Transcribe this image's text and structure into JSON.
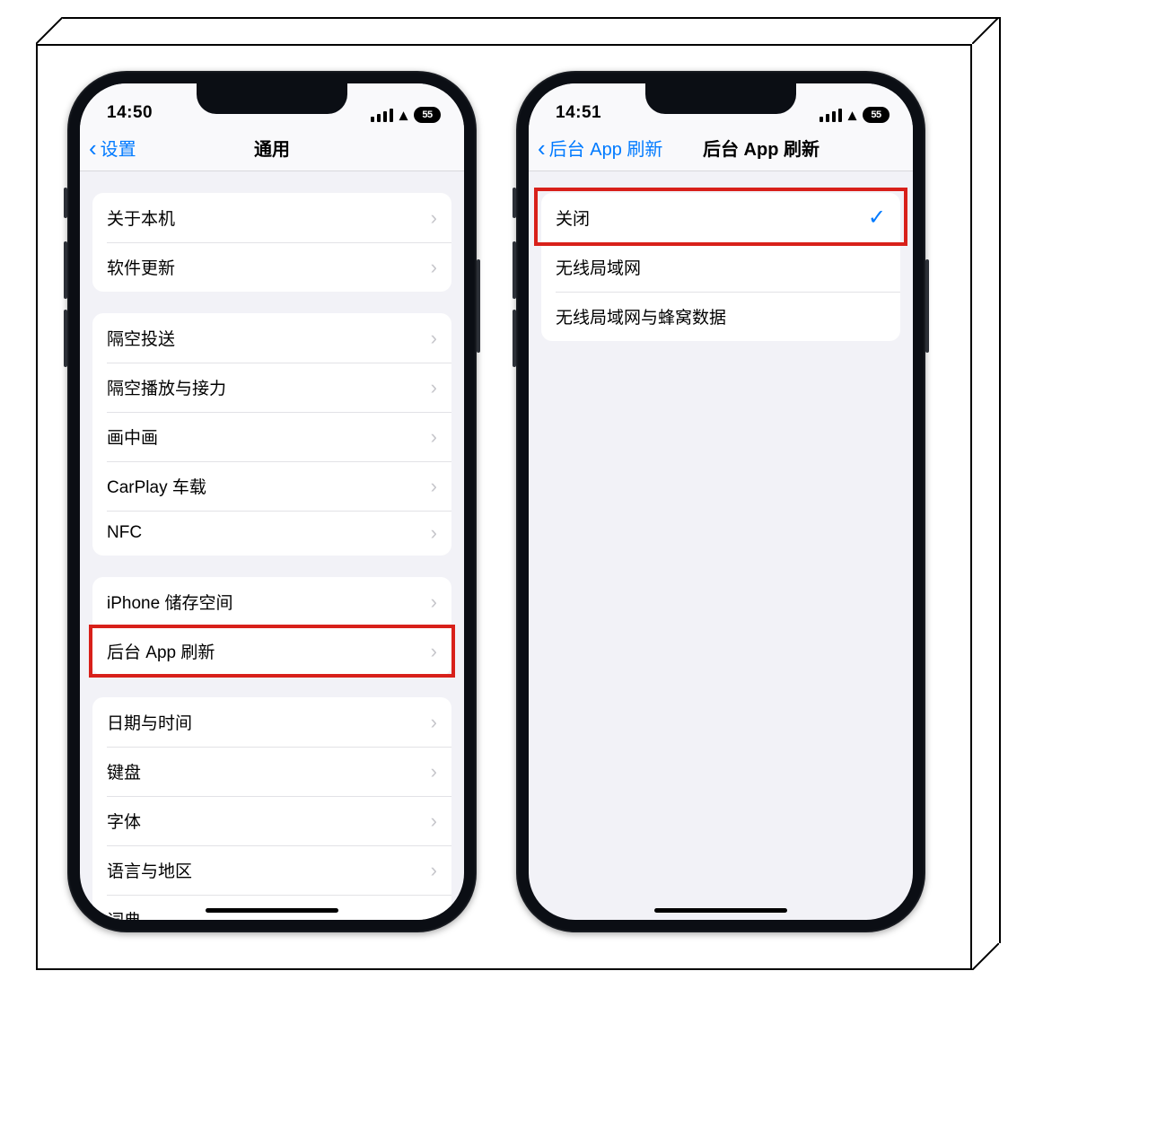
{
  "phoneLeft": {
    "time": "14:50",
    "battery": "55",
    "backLabel": "设置",
    "title": "通用",
    "groups": [
      {
        "rows": [
          {
            "label": "关于本机",
            "name": "row-about"
          },
          {
            "label": "软件更新",
            "name": "row-software-update"
          }
        ]
      },
      {
        "rows": [
          {
            "label": "隔空投送",
            "name": "row-airdrop"
          },
          {
            "label": "隔空播放与接力",
            "name": "row-airplay-handoff"
          },
          {
            "label": "画中画",
            "name": "row-pip"
          },
          {
            "label": "CarPlay 车载",
            "name": "row-carplay"
          },
          {
            "label": "NFC",
            "name": "row-nfc"
          }
        ]
      },
      {
        "rows": [
          {
            "label": "iPhone 储存空间",
            "name": "row-iphone-storage"
          },
          {
            "label": "后台 App 刷新",
            "name": "row-background-app-refresh",
            "highlight": true
          }
        ]
      },
      {
        "rows": [
          {
            "label": "日期与时间",
            "name": "row-date-time"
          },
          {
            "label": "键盘",
            "name": "row-keyboard"
          },
          {
            "label": "字体",
            "name": "row-fonts"
          },
          {
            "label": "语言与地区",
            "name": "row-language-region"
          },
          {
            "label": "词典",
            "name": "row-dictionary"
          }
        ]
      }
    ]
  },
  "phoneRight": {
    "time": "14:51",
    "battery": "55",
    "backLabel": "后台 App 刷新",
    "title": "后台 App 刷新",
    "options": [
      {
        "label": "关闭",
        "name": "option-off",
        "selected": true,
        "highlight": true
      },
      {
        "label": "无线局域网",
        "name": "option-wifi",
        "selected": false
      },
      {
        "label": "无线局域网与蜂窝数据",
        "name": "option-wifi-cellular",
        "selected": false
      }
    ]
  }
}
